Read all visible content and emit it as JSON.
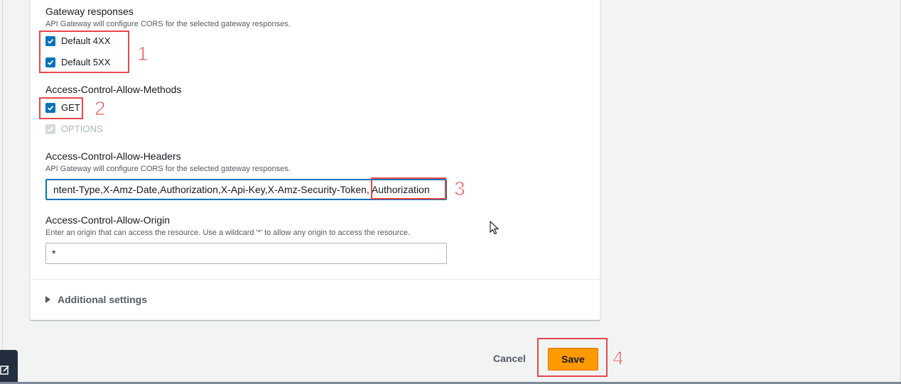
{
  "gateway_responses": {
    "label": "Gateway responses",
    "description": "API Gateway will configure CORS for the selected gateway responses.",
    "options": [
      {
        "label": "Default 4XX",
        "checked": true
      },
      {
        "label": "Default 5XX",
        "checked": true
      }
    ]
  },
  "allow_methods": {
    "label": "Access-Control-Allow-Methods",
    "options": [
      {
        "label": "GET",
        "checked": true
      },
      {
        "label": "OPTIONS",
        "checked": true,
        "disabled": true
      }
    ]
  },
  "allow_headers": {
    "label": "Access-Control-Allow-Headers",
    "description": "API Gateway will configure CORS for the selected gateway responses.",
    "value": "ntent-Type,X-Amz-Date,Authorization,X-Api-Key,X-Amz-Security-Token, Authorization"
  },
  "allow_origin": {
    "label": "Access-Control-Allow-Origin",
    "description": "Enter an origin that can access the resource. Use a wildcard '*' to allow any origin to access the resource.",
    "value": "*"
  },
  "additional_settings": {
    "label": "Additional settings"
  },
  "footer": {
    "cancel_label": "Cancel",
    "save_label": "Save"
  },
  "annotations": [
    "1",
    "2",
    "3",
    "4"
  ],
  "colors": {
    "accent": "#0073bb",
    "primary_button": "#ff9900",
    "annotation": "#e7474b"
  },
  "icons": {
    "checkbox": "checkmark-icon",
    "expand": "caret-right-icon",
    "feedback": "edit-icon",
    "cursor": "mouse-pointer-icon"
  }
}
